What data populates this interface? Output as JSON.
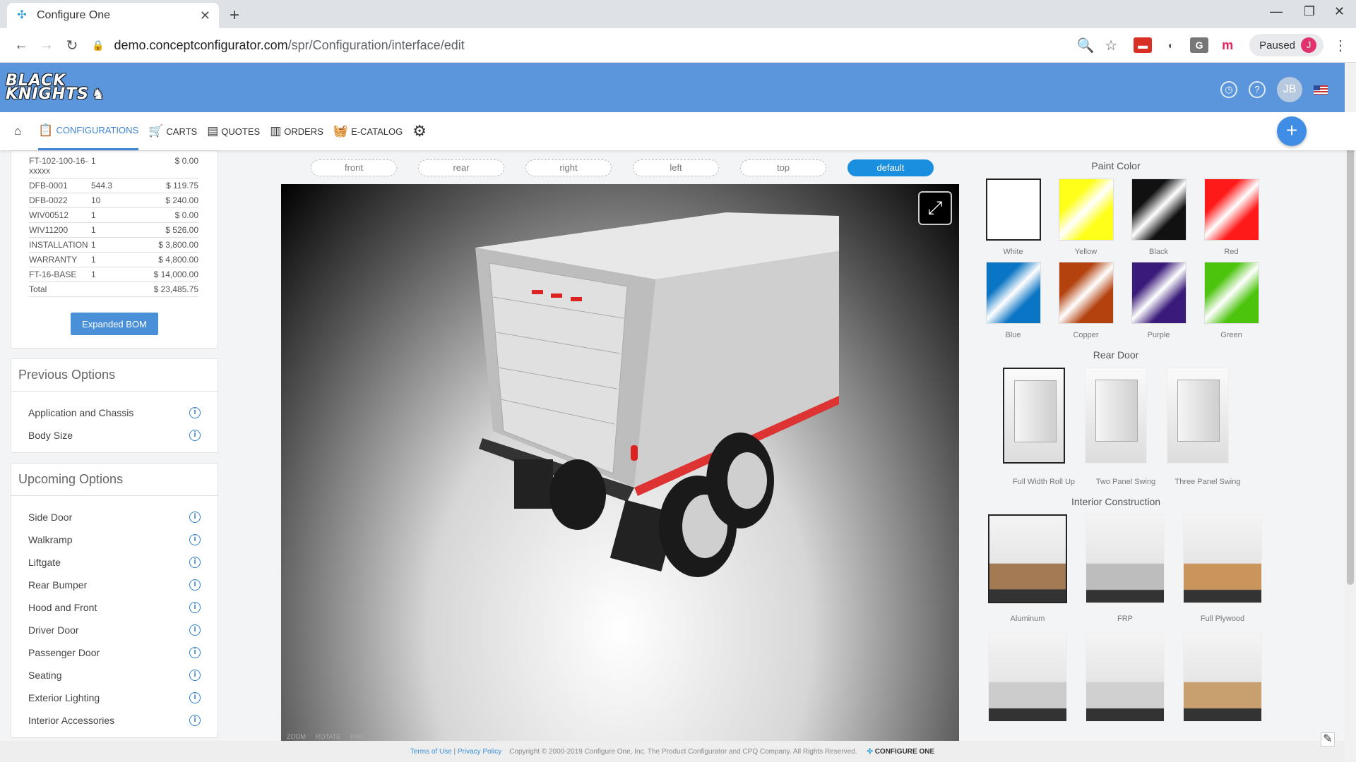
{
  "browser": {
    "tab_title": "Configure One",
    "url_host": "demo.conceptconfigurator.com",
    "url_path": "/spr/Configuration/interface/edit",
    "profile_status": "Paused",
    "profile_initial": "J"
  },
  "header": {
    "logo_line1": "BLACK",
    "logo_line2": "KNIGHTS",
    "user_initials": "JB"
  },
  "nav": {
    "items": [
      {
        "label": "CONFIGURATIONS",
        "icon": "clipboard-icon"
      },
      {
        "label": "CARTS",
        "icon": "cart-icon"
      },
      {
        "label": "QUOTES",
        "icon": "quote-icon"
      },
      {
        "label": "ORDERS",
        "icon": "document-icon"
      },
      {
        "label": "E-CATALOG",
        "icon": "basket-icon"
      }
    ]
  },
  "bom": {
    "rows": [
      {
        "part": "FT-102-100-16-xxxxx",
        "qty": "1",
        "amount": "$ 0.00"
      },
      {
        "part": "DFB-0001",
        "qty": "544.3",
        "amount": "$ 119.75"
      },
      {
        "part": "DFB-0022",
        "qty": "10",
        "amount": "$ 240.00"
      },
      {
        "part": "WIV00512",
        "qty": "1",
        "amount": "$ 0.00"
      },
      {
        "part": "WIV11200",
        "qty": "1",
        "amount": "$ 526.00"
      },
      {
        "part": "INSTALLATION",
        "qty": "1",
        "amount": "$ 3,800.00"
      },
      {
        "part": "WARRANTY",
        "qty": "1",
        "amount": "$ 4,800.00"
      },
      {
        "part": "FT-16-BASE",
        "qty": "1",
        "amount": "$ 14,000.00"
      }
    ],
    "total_label": "Total",
    "total_amount": "$ 23,485.75",
    "expanded_button": "Expanded BOM"
  },
  "previous_options": {
    "title": "Previous Options",
    "items": [
      "Application and Chassis",
      "Body Size"
    ]
  },
  "upcoming_options": {
    "title": "Upcoming Options",
    "items": [
      "Side Door",
      "Walkramp",
      "Liftgate",
      "Rear Bumper",
      "Hood and Front",
      "Driver Door",
      "Passenger Door",
      "Seating",
      "Exterior Lighting",
      "Interior Accessories"
    ]
  },
  "views": {
    "buttons": [
      "front",
      "rear",
      "right",
      "left",
      "top",
      "default"
    ],
    "selected": "default"
  },
  "viewer": {
    "hints": [
      "ZOOM",
      "ROTATE",
      "PAN"
    ]
  },
  "paint_color": {
    "title": "Paint Color",
    "selected": "White",
    "options": [
      {
        "label": "White",
        "color": "#ffffff"
      },
      {
        "label": "Yellow",
        "color": "#ffff1a"
      },
      {
        "label": "Black",
        "color": "#111111"
      },
      {
        "label": "Red",
        "color": "#ff1a1a"
      },
      {
        "label": "Blue",
        "color": "#0a75c4"
      },
      {
        "label": "Copper",
        "color": "#b3420f"
      },
      {
        "label": "Purple",
        "color": "#3a1a7a"
      },
      {
        "label": "Green",
        "color": "#4cc40e"
      }
    ]
  },
  "rear_door": {
    "title": "Rear Door",
    "selected": "Full Width Roll Up",
    "options": [
      "Full Width Roll Up",
      "Two Panel Swing",
      "Three Panel Swing"
    ]
  },
  "interior_construction": {
    "title": "Interior Construction",
    "selected": "Aluminum",
    "options": [
      {
        "label": "Aluminum",
        "floor": "#a47a55"
      },
      {
        "label": "FRP",
        "floor": "#bdbdbd"
      },
      {
        "label": "Full Plywood",
        "floor": "#c9955d"
      },
      {
        "label": "",
        "floor": "#cccccc"
      },
      {
        "label": "",
        "floor": "#d0d0d0"
      },
      {
        "label": "",
        "floor": "#c8a070"
      }
    ]
  },
  "footer": {
    "terms": "Terms of Use",
    "privacy": "Privacy Policy",
    "copyright": "Copyright © 2000-2019 Configure One, Inc. The Product Configurator and CPQ Company. All Rights Reserved.",
    "brand": "CONFIGURE ONE"
  }
}
